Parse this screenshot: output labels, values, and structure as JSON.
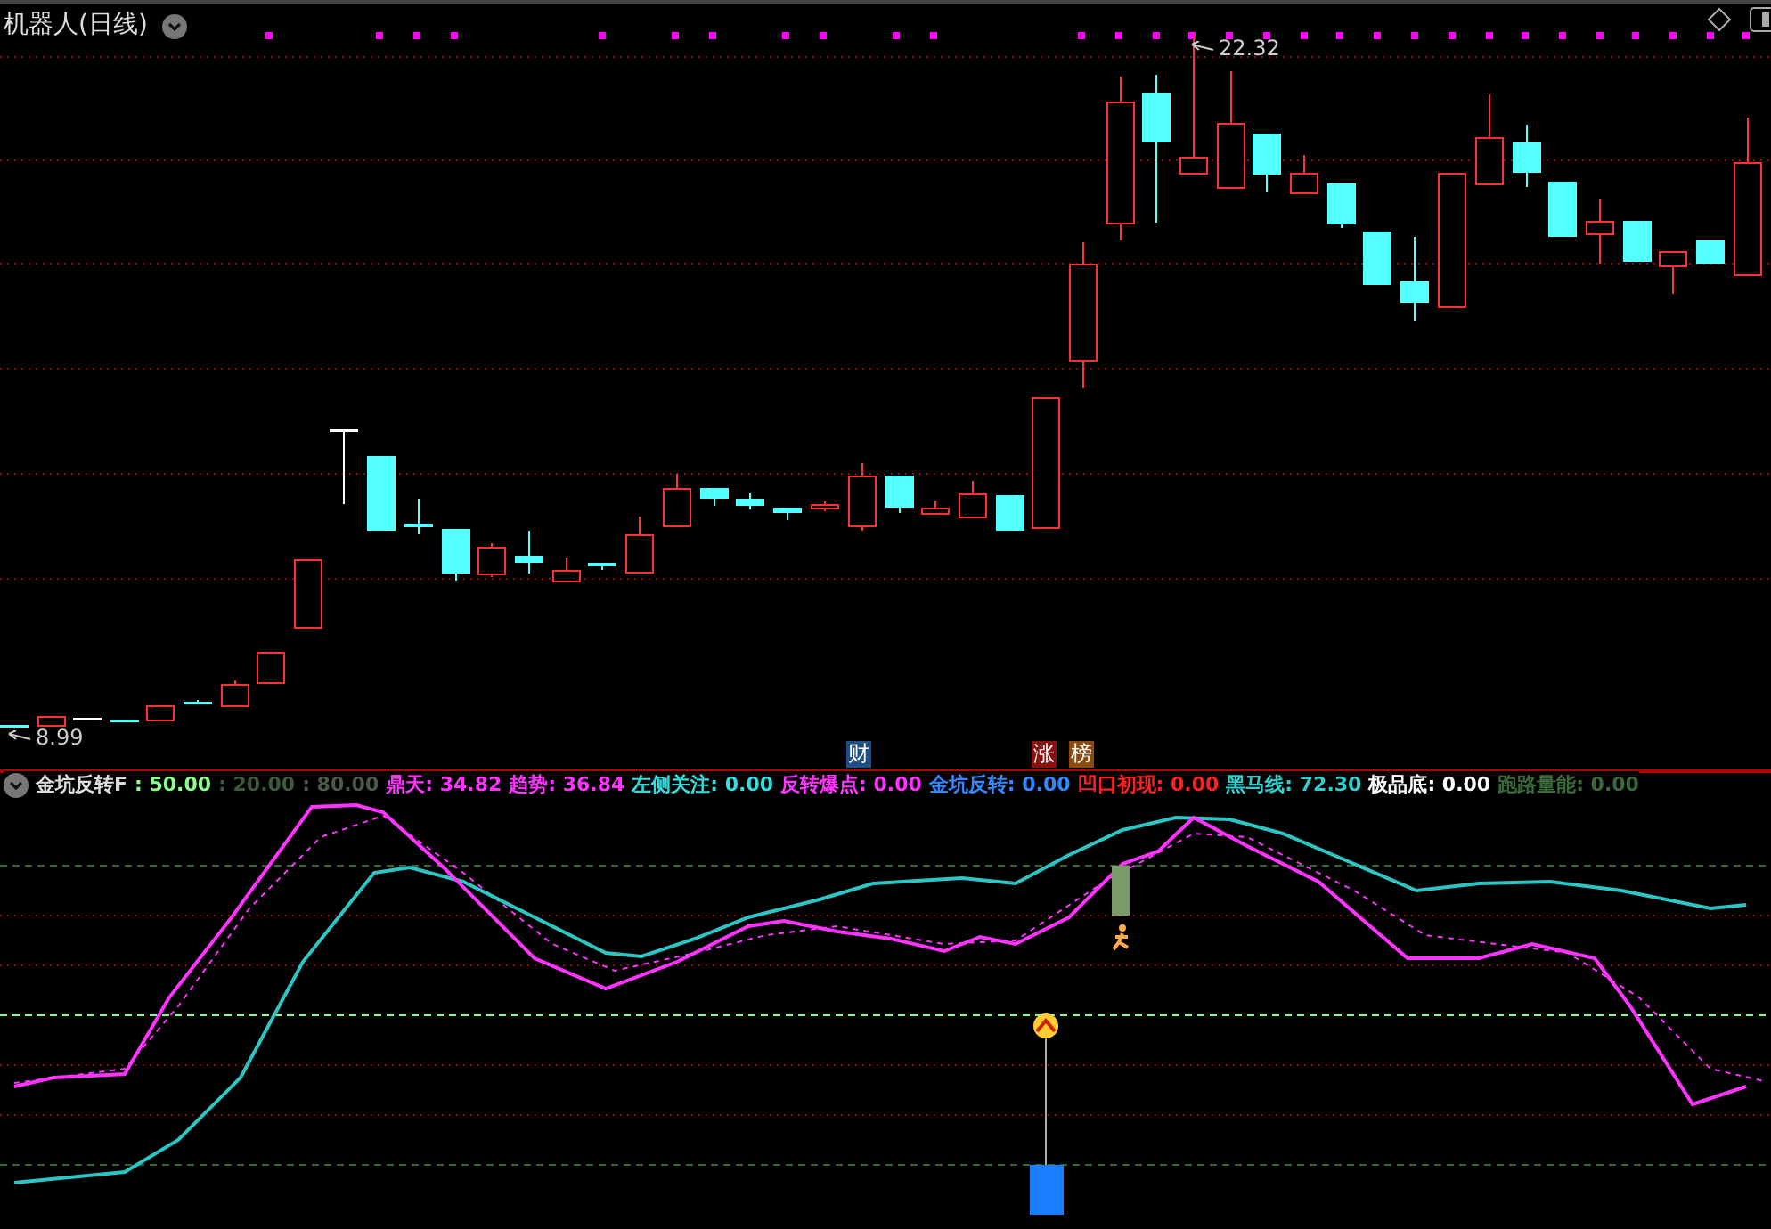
{
  "chart": {
    "title": "机器人(日线)",
    "max_label": "22.32",
    "min_label": "8.99",
    "markers": [
      {
        "text": "财",
        "color": "#1e4f86"
      },
      {
        "text": "涨",
        "color": "#8b1010"
      },
      {
        "text": "榜",
        "color": "#8a4a10"
      }
    ]
  },
  "indicator": {
    "name": "金坑反转F",
    "values": [
      {
        "text": ": 50.00",
        "color": "#8cff8c"
      },
      {
        "text": ": 20.00",
        "color": "#3a5a3a"
      },
      {
        "text": ": 80.00",
        "color": "#4a5a4a"
      },
      {
        "text": "鼎天: 34.82",
        "color": "#ff33ff"
      },
      {
        "text": "趋势: 36.84",
        "color": "#ff33ff"
      },
      {
        "text": "左侧关注: 0.00",
        "color": "#33dddd"
      },
      {
        "text": "反转爆点: 0.00",
        "color": "#ff33ff"
      },
      {
        "text": "金坑反转: 0.00",
        "color": "#3388ff"
      },
      {
        "text": "凹口初现: 0.00",
        "color": "#ff2020"
      },
      {
        "text": "黑马线: 72.30",
        "color": "#33cccc"
      },
      {
        "text": "极品底: 0.00",
        "color": "#ffffff"
      },
      {
        "text": "跑路量能: 0.00",
        "color": "#3a6a3a"
      }
    ]
  }
}
